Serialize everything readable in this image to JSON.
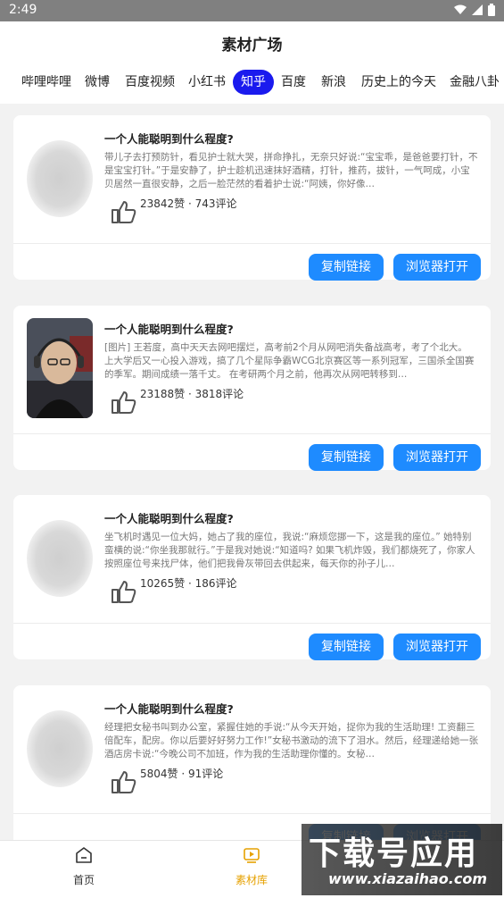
{
  "status": {
    "time": "2:49"
  },
  "header": {
    "title": "素材广场"
  },
  "tabs": [
    {
      "label": "哔哩哔哩"
    },
    {
      "label": "微博"
    },
    {
      "label": "百度视频"
    },
    {
      "label": "小红书"
    },
    {
      "label": "知乎",
      "active": true
    },
    {
      "label": "百度"
    },
    {
      "label": "新浪"
    },
    {
      "label": "历史上的今天"
    },
    {
      "label": "金融八卦"
    }
  ],
  "cards": [
    {
      "title": "一个人能聪明到什么程度?",
      "desc": "带儿子去打预防针，看见护士就大哭，拼命挣扎，无奈只好说:“宝宝乖，是爸爸要打针，不是宝宝打针。”于是安静了，护士趁机迅速抹好酒精，打针，推药，拔针，一气呵成，小宝贝居然一直很安静，之后一脸茫然的看着护士说:“阿姨，你好像…",
      "stats": "23842赞 · 743评论",
      "has_photo": false
    },
    {
      "title": "一个人能聪明到什么程度?",
      "desc": "[图片] 王若度，高中天天去网吧摆烂，高考前2个月从网吧消失备战高考，考了个北大。 上大学后又一心投入游戏，搞了几个星际争霸WCG北京赛区等一系列冠军，三国杀全国赛的季军。期间成绩一落千丈。 在考研两个月之前，他再次从网吧转移到…",
      "stats": "23188赞 · 3818评论",
      "has_photo": true
    },
    {
      "title": "一个人能聪明到什么程度?",
      "desc": "坐飞机时遇见一位大妈，她占了我的座位，我说:“麻烦您挪一下，这是我的座位。” 她特别蛮横的说:“你坐我那就行。”于是我对她说:“知道吗? 如果飞机炸毁，我们都烧死了，你家人按照座位号来找尸体，他们把我骨灰带回去供起来，每天你的孙子儿…",
      "stats": "10265赞 · 186评论",
      "has_photo": false
    },
    {
      "title": "一个人能聪明到什么程度?",
      "desc": "经理把女秘书叫到办公室，紧握住她的手说:“从今天开始，捉你为我的生活助理! 工资翻三倍配车，配房。你以后要好好努力工作!”女秘书激动的流下了泪水。然后，经理递给她一张酒店房卡说:“今晚公司不加班，作为我的生活助理你懂的。女秘…",
      "stats": "5804赞 · 91评论",
      "has_photo": false
    }
  ],
  "buttons": {
    "copy": "复制链接",
    "open": "浏览器打开"
  },
  "nav": {
    "home": "首页",
    "library": "素材库"
  },
  "watermark": {
    "big": "下载号应用",
    "small": "www.xiazaihao.com"
  },
  "colors": {
    "accent": "#1e8bff",
    "tab_active": "#1a1aee",
    "nav_active": "#e6a100"
  }
}
